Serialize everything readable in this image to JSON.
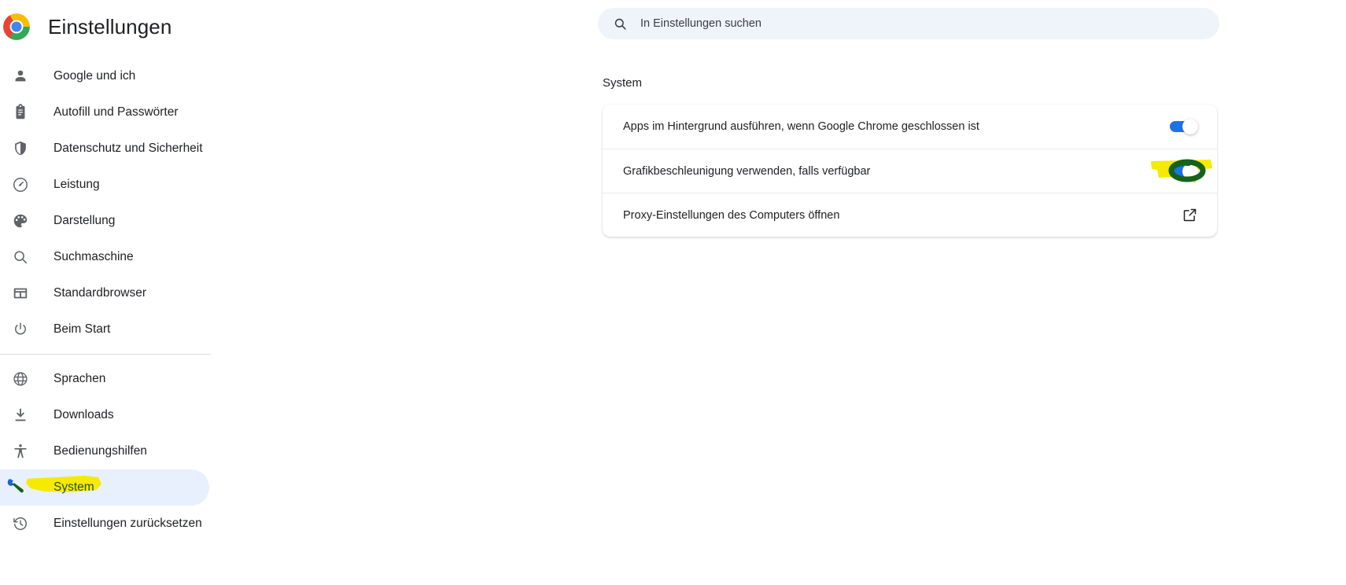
{
  "app": {
    "title": "Einstellungen",
    "logo_icon": "chrome-logo"
  },
  "sidebar": {
    "items": [
      {
        "label": "Google und ich",
        "icon": "person-icon",
        "selected": false
      },
      {
        "label": "Autofill und Passwörter",
        "icon": "clipboard-icon",
        "selected": false
      },
      {
        "label": "Datenschutz und Sicherheit",
        "icon": "shield-icon",
        "selected": false
      },
      {
        "label": "Leistung",
        "icon": "speedometer-icon",
        "selected": false
      },
      {
        "label": "Darstellung",
        "icon": "palette-icon",
        "selected": false
      },
      {
        "label": "Suchmaschine",
        "icon": "search-icon",
        "selected": false
      },
      {
        "label": "Standardbrowser",
        "icon": "browser-window-icon",
        "selected": false
      },
      {
        "label": "Beim Start",
        "icon": "power-icon",
        "selected": false
      },
      {
        "label": "Sprachen",
        "icon": "globe-icon",
        "selected": false
      },
      {
        "label": "Downloads",
        "icon": "download-icon",
        "selected": false
      },
      {
        "label": "Bedienungshilfen",
        "icon": "accessibility-icon",
        "selected": false
      },
      {
        "label": "System",
        "icon": "wrench-icon",
        "selected": true
      },
      {
        "label": "Einstellungen zurücksetzen",
        "icon": "history-restore-icon",
        "selected": false
      }
    ]
  },
  "search": {
    "placeholder": "In Einstellungen suchen",
    "value": "",
    "icon": "search-icon"
  },
  "main": {
    "section_title": "System",
    "rows": [
      {
        "label": "Apps im Hintergrund ausführen, wenn Google Chrome geschlossen ist",
        "control": "toggle",
        "state": "on",
        "highlighted": false
      },
      {
        "label": "Grafikbeschleunigung verwenden, falls verfügbar",
        "control": "toggle",
        "state": "on",
        "highlighted": true
      },
      {
        "label": "Proxy-Einstellungen des Computers öffnen",
        "control": "external-link-icon",
        "state": "",
        "highlighted": false
      }
    ]
  },
  "annotations": {
    "highlight_color": "#f5ea00",
    "pen_color": "#15621a",
    "pen_blue": "#1a62d8",
    "marked_sidebar_item": "System",
    "marked_row": "Grafikbeschleunigung verwenden, falls verfügbar"
  },
  "colors": {
    "accent": "#1a73e8",
    "selected_nav_bg": "#e8f0fe",
    "search_bg": "#eff3fa",
    "text": "#202124",
    "icon": "#5f6368",
    "divider": "#dadce0"
  }
}
